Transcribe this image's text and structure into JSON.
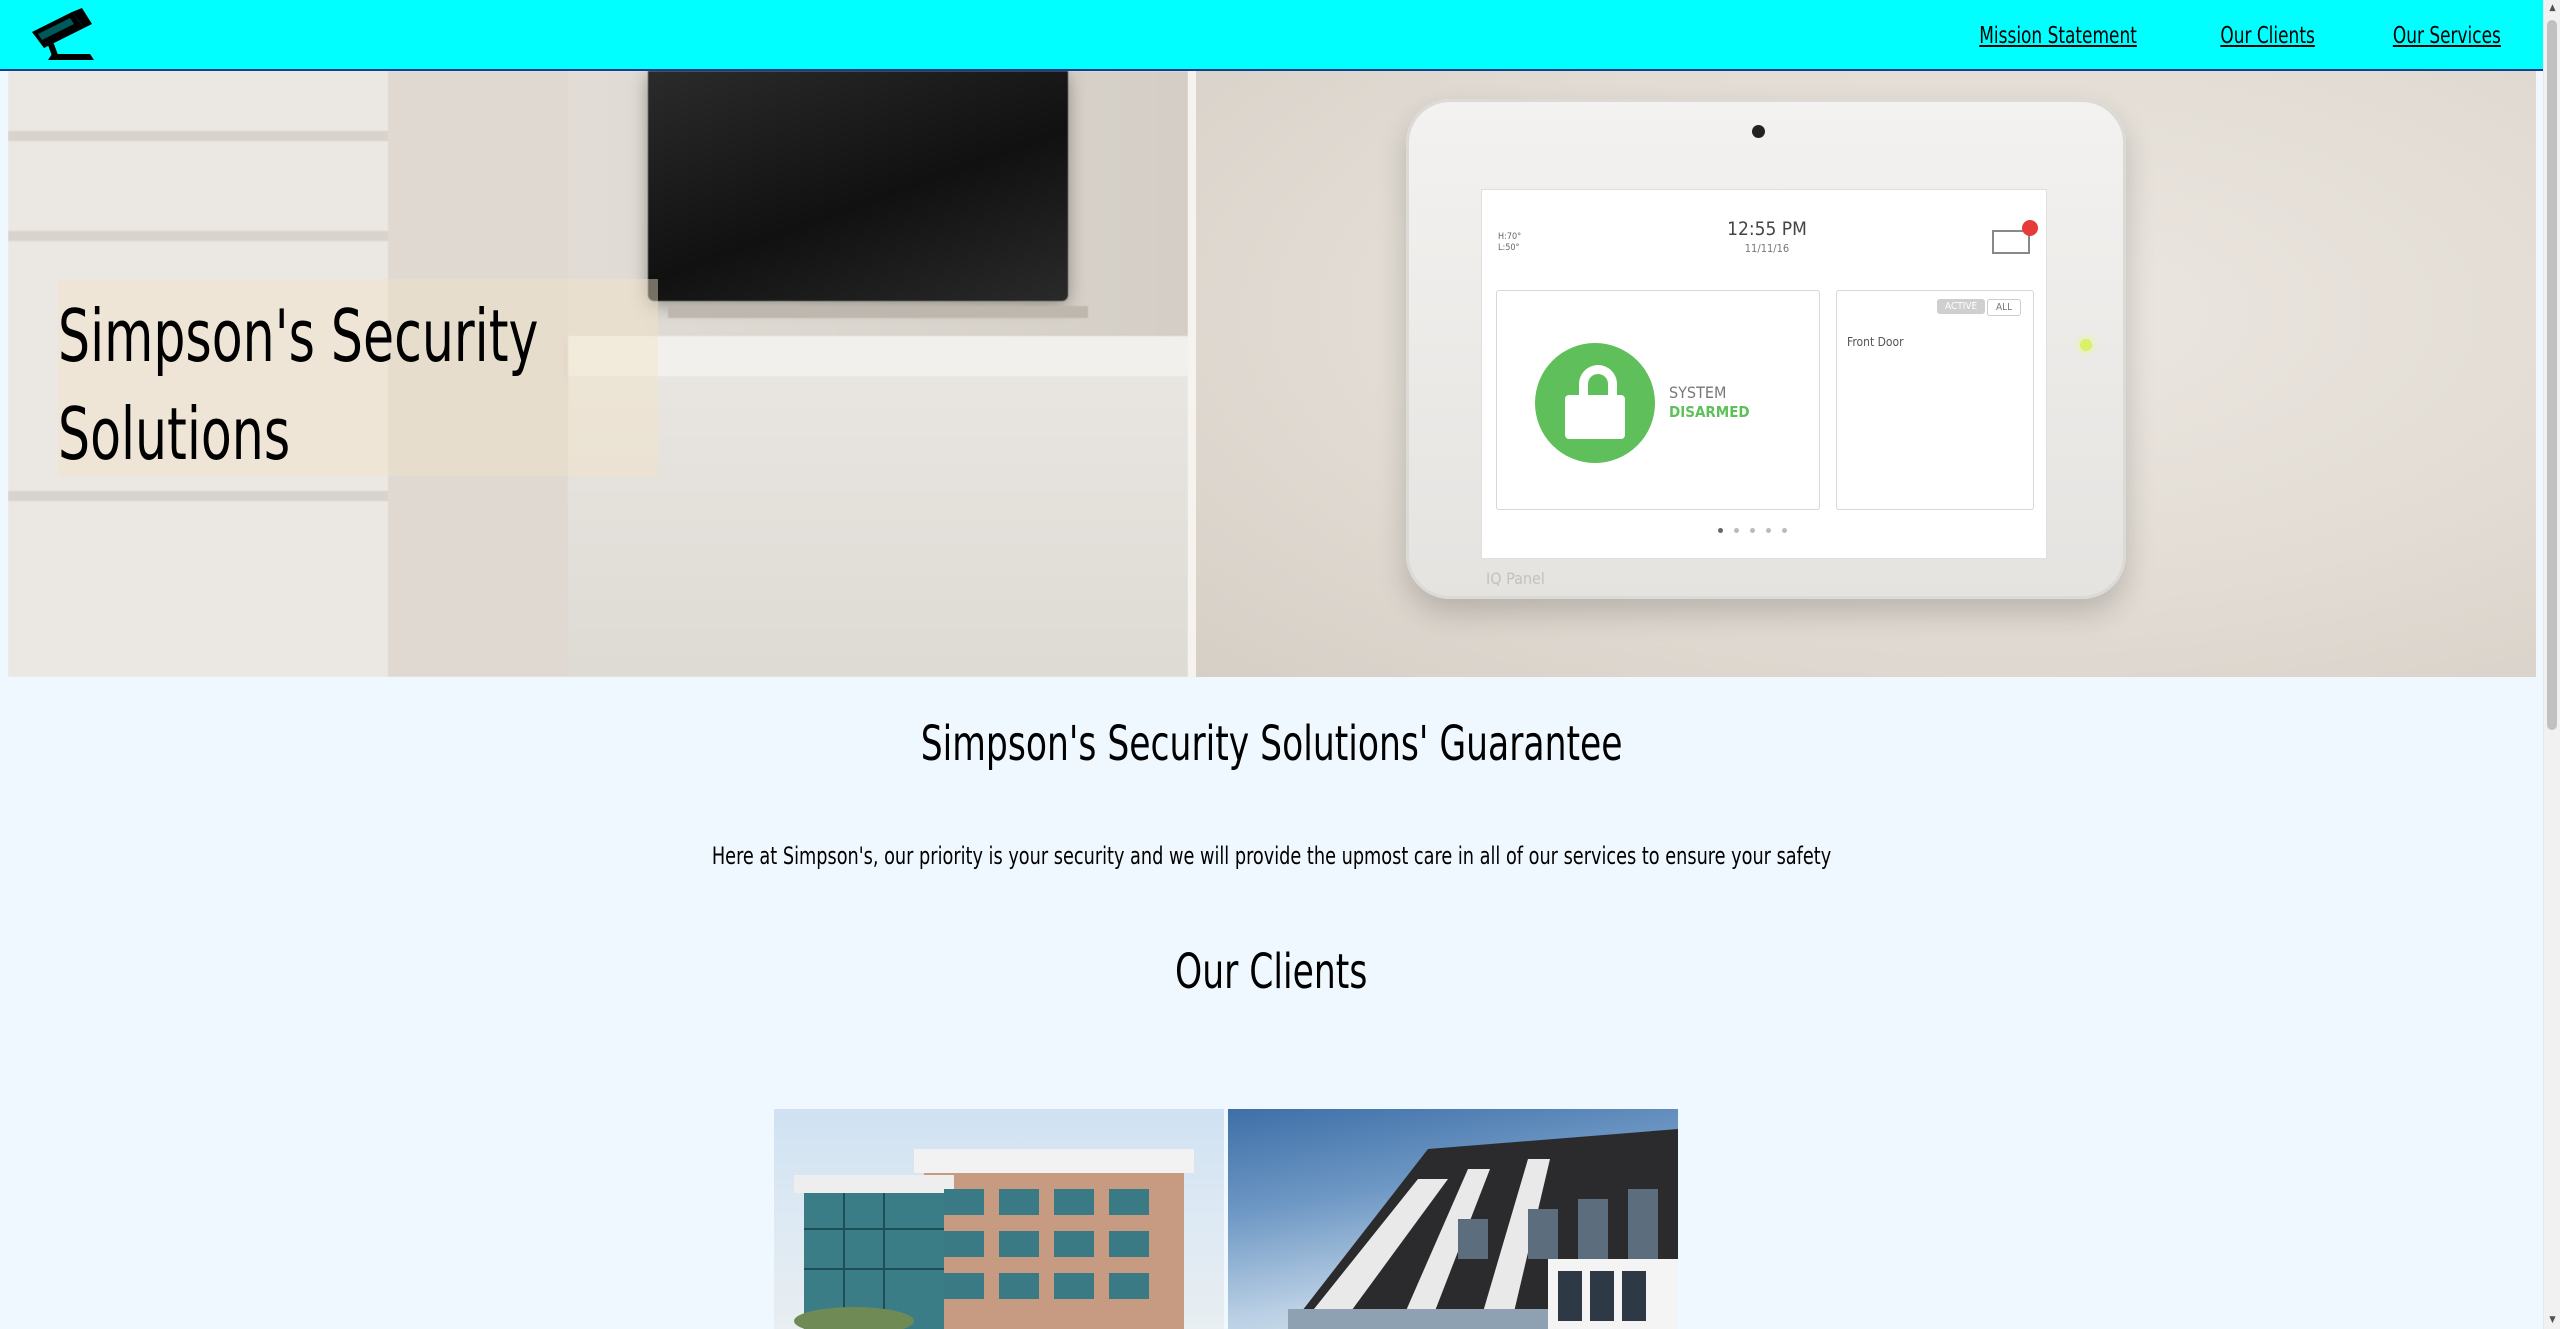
{
  "nav": {
    "logo_icon": "security-camera-icon",
    "links": [
      "Mission Statement",
      "Our Clients",
      "Our Services"
    ]
  },
  "hero": {
    "title": "Simpson's Security Solutions",
    "image_description": "blurred living room with TV and fireplace next to a wall-mounted security touchscreen panel",
    "panel": {
      "weather_hi": "H:70°",
      "weather_lo": "L:50°",
      "time": "12:55 PM",
      "date": "11/11/16",
      "status_line1": "SYSTEM",
      "status_line2": "DISARMED",
      "tab_active": "ACTIVE",
      "tab_all": "ALL",
      "sensor": "Front Door",
      "brand": "IQ Panel"
    }
  },
  "guarantee": {
    "title": "Simpson's Security Solutions' Guarantee",
    "text": "Here at Simpson's, our priority is your security and we will provide the upmost care in all of our services to ensure your safety"
  },
  "clients": {
    "title": "Our Clients"
  },
  "colors": {
    "navbar": "#00ffff",
    "page_background": "#f0f8ff",
    "text": "#000000",
    "disarmed_green": "#5fbf5a"
  }
}
